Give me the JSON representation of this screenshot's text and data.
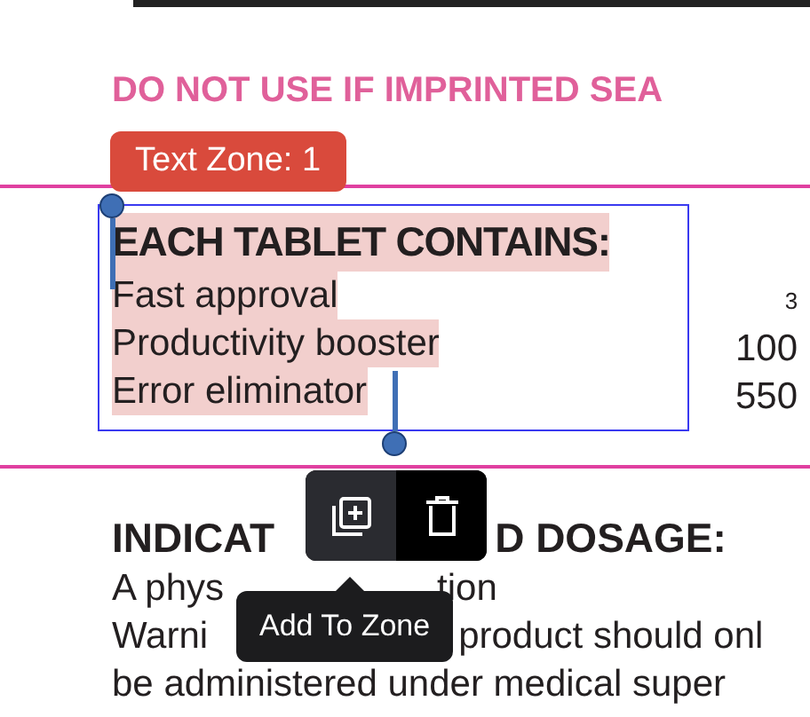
{
  "warning": "DO NOT USE IF IMPRINTED SEA",
  "zone": {
    "label": "Text Zone: 1",
    "heading": "EACH TABLET CONTAINS:",
    "lines": [
      {
        "text": "Fast approval",
        "amount": "3"
      },
      {
        "text": "Productivity booster",
        "amount": "100"
      },
      {
        "text": "Error eliminator",
        "amount": "550"
      }
    ]
  },
  "section": {
    "rows": [
      {
        "kind": "heading",
        "parts": [
          "INDICAT",
          "D DOSAGE:"
        ]
      },
      {
        "kind": "body",
        "parts": [
          "A phys",
          "tion"
        ]
      },
      {
        "kind": "body",
        "parts": [
          "Warni",
          "product should onl"
        ]
      },
      {
        "kind": "body",
        "parts": [
          "be administered under medical super"
        ]
      }
    ]
  },
  "toolbar": {
    "buttons": [
      {
        "kind": "add",
        "selected": true
      },
      {
        "kind": "delete",
        "selected": false
      }
    ],
    "tooltip": "Add To Zone"
  }
}
